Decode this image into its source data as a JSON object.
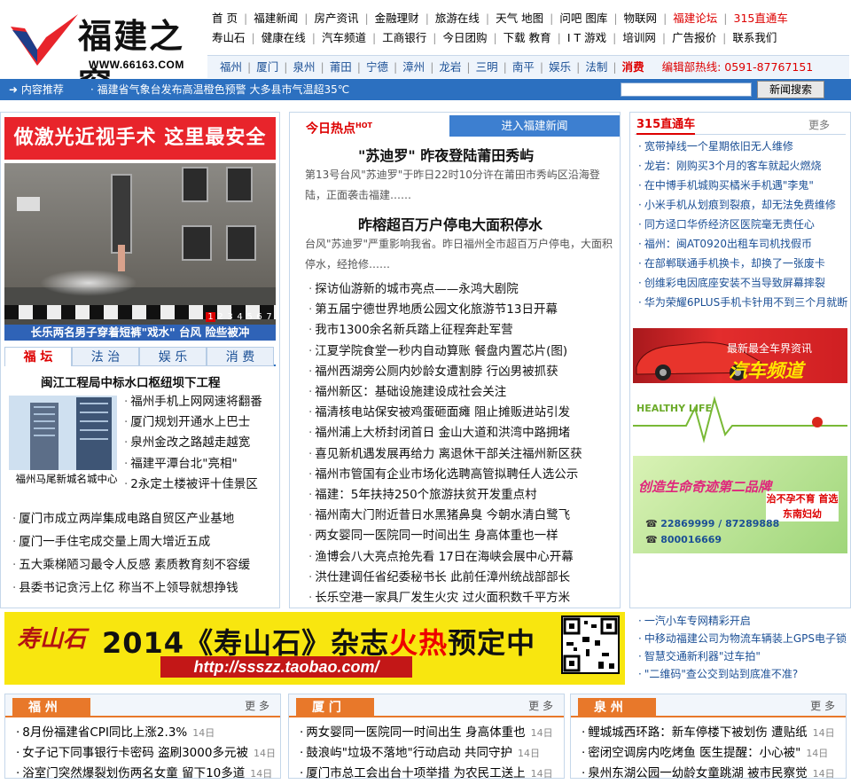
{
  "logo": {
    "brand": "福建之窗",
    "url": "WWW.66163.COM"
  },
  "nav": {
    "row1": [
      "首 页",
      "福建新闻",
      "房产资讯",
      "金融理财",
      "旅游在线",
      "天气 地图",
      "问吧 图库",
      "物联网",
      "福建论坛",
      "315直通车"
    ],
    "row2": [
      "寿山石",
      "健康在线",
      "汽车频道",
      "工商银行",
      "今日团购",
      "下载 教育",
      "I T 游戏",
      "培训网",
      "广告报价",
      "联系我们"
    ],
    "cities": [
      "福州",
      "厦门",
      "泉州",
      "莆田",
      "宁德",
      "漳州",
      "龙岩",
      "三明",
      "南平",
      "娱乐",
      "法制",
      "消费"
    ],
    "hotline": "编辑部热线: 0591-87767151"
  },
  "recommend_bar": {
    "label": "内容推荐",
    "text": "福建省气象台发布高温橙色预警 大多县市气温超35℃",
    "search_button": "新闻搜索",
    "search_value": ""
  },
  "left": {
    "ad_text": "做激光近视手术 这里最安全",
    "photo_caption": "长乐两名男子穿着短裤\"戏水\" 台风 险些被冲",
    "pager": [
      "1",
      "2",
      "3",
      "4",
      "5",
      "6",
      "7"
    ],
    "tabs": [
      "福 坛",
      "法 治",
      "娱 乐",
      "消 费"
    ],
    "feature_title": "闽江工程局中标水口枢纽坝下工程",
    "feature_img_caption": "福州马尾新城名城中心",
    "feature_items": [
      "福州手机上网网速将翻番",
      "厦门规划开通水上巴士",
      "泉州金改之路越走越宽",
      "福建平潭台北\"亮相\"",
      "2永定土楼被评十佳景区"
    ],
    "list": [
      "厦门市成立两岸集成电路自贸区产业基地",
      "厦门一手住宅成交量上周大增近五成",
      "五大乘梯陋习最令人反感 素质教育刻不容缓",
      "县委书记贪污上亿 称当不上领导就想挣钱"
    ]
  },
  "center": {
    "hot_label": "今日热点",
    "hot_sup": "HOT",
    "enter_label": "进入福建新闻",
    "headline1": "\"苏迪罗\" 昨夜登陆莆田秀屿",
    "desc1": "第13号台风\"苏迪罗\"于昨日22时10分许在莆田市秀屿区沿海登陆，正面袭击福建……",
    "headline2": "昨榕超百万户停电大面积停水",
    "desc2": "台风\"苏迪罗\"严重影响我省。昨日福州全市超百万户停电，大面积停水，经抢修……",
    "list": [
      "探访仙游新的城市亮点——永鸿大剧院",
      "第五届宁德世界地质公园文化旅游节13日开幕",
      "我市1300余名新兵踏上征程奔赴军营",
      "江夏学院食堂一秒内自动算账 餐盘内置芯片(图)",
      "福州西湖旁公厕内妙龄女遭割脖 行凶男被抓获",
      "福州新区：基础设施建设成社会关注",
      "福清核电站保安被鸡蛋砸面瘫 阻止摊贩进站引发",
      "福州浦上大桥封闭首日 金山大道和洪湾中路拥堵",
      "喜见新机遇发展再给力 离退休干部关注福州新区获",
      "福州市管国有企业市场化选聘高管拟聘任人选公示",
      "福建：5年扶持250个旅游扶贫开发重点村",
      "福州南大门附近昔日水黑猪鼻臭 今朝水清白鹭飞",
      "两女婴同一医院同一时间出生 身高体重也一样",
      "渔博会八大亮点抢先看 17日在海峡会展中心开幕",
      "洪仕建调任省纪委秘书长 此前任漳州统战部部长",
      "长乐空港一家具厂发生火灾 过火面积数千平方米"
    ]
  },
  "right": {
    "label": "315直通车",
    "more": "更多",
    "list": [
      "宽带掉线一个星期依旧无人维修",
      "龙岩：刚购买3个月的客车就起火燃烧",
      "在中博手机城购买橘米手机遇\"李鬼\"",
      "小米手机从划痕到裂痕，却无法免费维修",
      "同方迳口华侨经济区医院毫无责任心",
      "福州：闽AT0920出租车司机找假币",
      "在部郸联通手机换卡，却换了一张废卡",
      "创维彩电因底座安装不当导致屏幕摔裂",
      "华为荣耀6PLUS手机卡针用不到三个月就断"
    ],
    "car_ad_sub": "最新最全车界资讯",
    "car_ad_main": "汽车频道",
    "health_ad": "HEALTHY LIFE",
    "green_ad_title": "创造生命奇迹第二品牌",
    "green_ad_badge": "治不孕不育 首选东南妇幼",
    "green_ad_tel1": "22869999 / 87289888",
    "green_ad_tel2": "800016669"
  },
  "banner": {
    "mag": "寿山石",
    "slogan_pre": "2014《寿山石》杂志",
    "slogan_hot": "火热",
    "slogan_post": "预定中",
    "url": "http://ssszz.taobao.com/"
  },
  "banner_right_list": [
    "一汽小车专网精彩开启",
    "中移动福建公司为物流车辆装上GPS电子锁",
    "智慧交通新利器\"过车拍\"",
    "\"二维码\"查公交到站到底准不准?"
  ],
  "cities": [
    {
      "name": "福 州",
      "more": "更 多",
      "items": [
        {
          "t": "8月份福建省CPI同比上涨2.3%",
          "d": "14日"
        },
        {
          "t": "女子记下同事银行卡密码 盗刷3000多元被",
          "d": "14日"
        },
        {
          "t": "浴室门突然爆裂划伤两名女童 留下10多道",
          "d": "14日"
        }
      ]
    },
    {
      "name": "厦 门",
      "more": "更 多",
      "items": [
        {
          "t": "两女婴同一医院同一时间出生 身高体重也",
          "d": "14日"
        },
        {
          "t": "鼓浪屿\"垃圾不落地\"行动启动 共同守护",
          "d": "14日"
        },
        {
          "t": "厦门市总工会出台十项举措 为农民工送上",
          "d": "14日"
        }
      ]
    },
    {
      "name": "泉 州",
      "more": "更 多",
      "items": [
        {
          "t": "鲤城城西环路：新车停楼下被划伤 遭贴纸",
          "d": "14日"
        },
        {
          "t": "密闭空调房内吃烤鱼 医生提醒：小心被\"",
          "d": "14日"
        },
        {
          "t": "泉州东湖公园一幼龄女童跳湖 被市民察觉",
          "d": "14日"
        }
      ]
    }
  ],
  "colors": {
    "brand_blue": "#2c70c0",
    "accent_red": "#e8242b",
    "city_orange": "#e8782a"
  }
}
